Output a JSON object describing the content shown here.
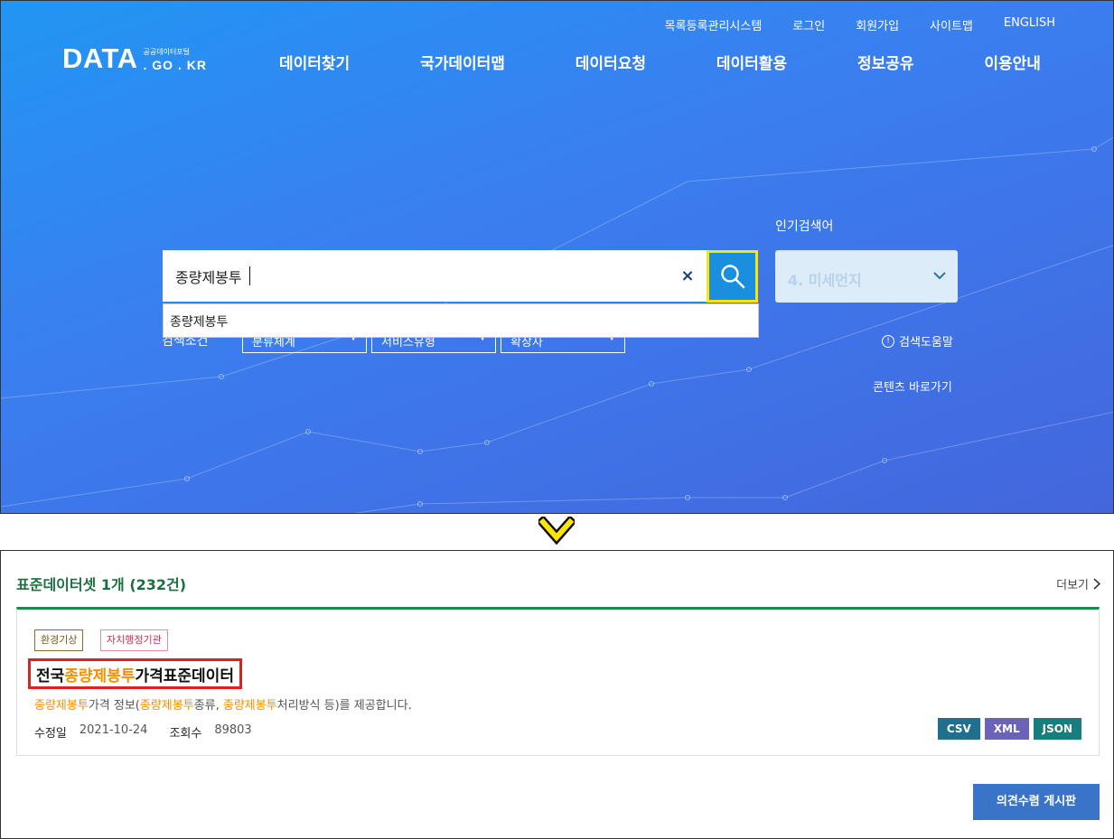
{
  "header": {
    "util_nav": [
      "목록등록관리시스템",
      "로그인",
      "회원가입",
      "사이트맵",
      "ENGLISH"
    ],
    "logo": {
      "main": "DATA",
      "sub": "공공데이터포털",
      "domain": ". GO . KR"
    },
    "gnb": [
      "데이터찾기",
      "국가데이터맵",
      "데이터요청",
      "데이터활용",
      "정보공유",
      "이용안내"
    ]
  },
  "search": {
    "value": "종량제봉투",
    "clear_label": "×",
    "autocomplete": [
      "종량제봉투"
    ]
  },
  "filters": {
    "label": "검색조건",
    "selects": [
      "분류체계",
      "서비스유형",
      "확장자"
    ]
  },
  "popular": {
    "title": "인기검색어",
    "selected": "4. 미세먼지"
  },
  "links": {
    "search_help": "검색도움말",
    "content_shortcut": "콘텐츠 바로가기"
  },
  "results": {
    "section_title": "표준데이터셋 1개 (232건)",
    "more_label": "더보기",
    "card": {
      "tags": [
        "환경기상",
        "자치행정기관"
      ],
      "title_parts": {
        "pre": "전국",
        "highlight": "종량제봉투",
        "post": "가격표준데이터"
      },
      "desc_parts": {
        "h1": "종량제봉투",
        "t1": "가격 정보(",
        "h2": "종량제봉투",
        "t2": "종류, ",
        "h3": "종량제봉투",
        "t3": "처리방식 등)를 제공합니다."
      },
      "meta": {
        "updated_label": "수정일",
        "updated_value": "2021-10-24",
        "views_label": "조회수",
        "views_value": "89803"
      },
      "formats": [
        "CSV",
        "XML",
        "JSON"
      ]
    },
    "opinion_button": "의견수렴 게시판"
  },
  "colors": {
    "hero_start": "#2196f3",
    "hero_end": "#4466dd",
    "search_button": "#1a8fe0",
    "search_button_border": "#ffe600",
    "section_green": "#1c7040",
    "highlight_orange": "#f29100",
    "title_box_red": "#e41d1d",
    "csv": "#1f6f8e",
    "xml": "#6b63b8",
    "json": "#177d7d",
    "opinion_button": "#3a74c8"
  }
}
